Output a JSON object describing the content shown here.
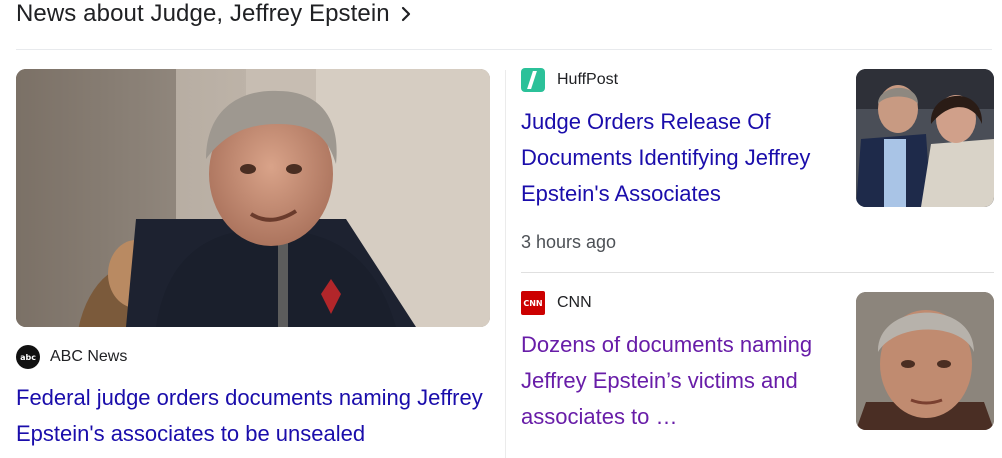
{
  "header": {
    "title": "News about Judge, Jeffrey Epstein"
  },
  "main_story": {
    "source": "ABC News",
    "source_logo_text": "abc",
    "title": "Federal judge orders documents naming Jeffrey Epstein's associates to be unsealed"
  },
  "stories": [
    {
      "source": "HuffPost",
      "title": "Judge Orders Release Of Documents Identifying Jeffrey Epstein's Associates",
      "time": "3 hours ago"
    },
    {
      "source": "CNN",
      "source_logo_text": "CNN",
      "title": "Dozens of documents naming Jeffrey Epstein’s victims and associates to …"
    }
  ],
  "colors": {
    "link": "#1a0dab",
    "visited": "#681da8",
    "huffpost": "#2bc199",
    "cnn": "#cc0000"
  }
}
